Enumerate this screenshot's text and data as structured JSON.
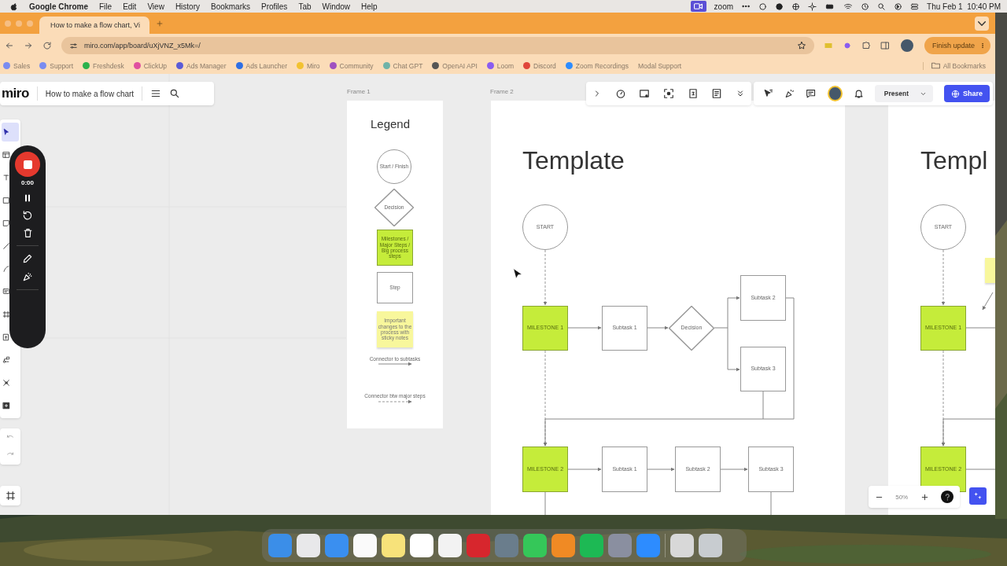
{
  "menu_bar": {
    "app_name": "Google Chrome",
    "menus": [
      "File",
      "Edit",
      "View",
      "History",
      "Bookmarks",
      "Profiles",
      "Tab",
      "Window",
      "Help"
    ],
    "zoom_label": "zoom",
    "clock": "Thu Feb 1  10:40 PM"
  },
  "browser": {
    "tabs": [
      {
        "title": "How to make a flow chart, Vi",
        "selected": true
      }
    ],
    "address": "miro.com/app/board/uXjVNZ_x5Mk=/",
    "update_button": "Finish update",
    "bookmarks": [
      "Sales",
      "Support",
      "Freshdesk",
      "ClickUp",
      "Ads Manager",
      "Ads Launcher",
      "Miro",
      "Community",
      "Chat GPT",
      "OpenAI API",
      "Loom",
      "Discord",
      "Zoom Recordings",
      "Modal Support"
    ],
    "all_bookmarks": "All Bookmarks"
  },
  "board": {
    "logo": "miro",
    "title": "How to make a flow chart",
    "tools": [
      {
        "selected": true
      },
      {
        "selected": false
      },
      {
        "selected": false
      },
      {
        "selected": false
      },
      {
        "selected": false
      },
      {
        "selected": false
      },
      {
        "selected": false
      },
      {
        "selected": false
      },
      {
        "selected": false
      },
      {
        "selected": false
      },
      {
        "selected": false
      },
      {
        "selected": false
      },
      {
        "selected": false
      }
    ],
    "recorder": {
      "time": "0:00"
    },
    "present_button": "Present",
    "share_button": "Share",
    "zoom_level": "50%",
    "frames": [
      {
        "label": "Frame 1",
        "title": "Legend",
        "items": [
          {
            "kind": "start",
            "label": "Start / Finish"
          },
          {
            "kind": "decision",
            "label": "Decision"
          },
          {
            "kind": "milestone",
            "label": "Milestones / Major Steps / Big process steps"
          },
          {
            "kind": "step",
            "label": "Step"
          },
          {
            "kind": "note",
            "label": "Important changes to the process with sticky notes"
          },
          {
            "kind": "connector",
            "label": "Connector to subtasks"
          },
          {
            "kind": "dashed_connector",
            "label": "Connector btw major steps"
          }
        ]
      },
      {
        "label": "Frame 2",
        "title": "Template",
        "nodes": [
          {
            "kind": "start",
            "label": "START"
          },
          {
            "kind": "milestone",
            "label": "MILESTONE 1"
          },
          {
            "kind": "step",
            "label": "Subtask 1"
          },
          {
            "kind": "decision",
            "label": "Decision"
          },
          {
            "kind": "step",
            "label": "Subtask 2"
          },
          {
            "kind": "step",
            "label": "Subtask 3"
          },
          {
            "kind": "milestone",
            "label": "MILESTONE 2"
          },
          {
            "kind": "step",
            "label": "Subtask 1"
          },
          {
            "kind": "step",
            "label": "Subtask 2"
          },
          {
            "kind": "step",
            "label": "Subtask 3"
          }
        ]
      },
      {
        "title": "Templ",
        "nodes": [
          {
            "kind": "start",
            "label": "START"
          },
          {
            "kind": "note"
          },
          {
            "kind": "milestone",
            "label": "MILESTONE 1"
          },
          {
            "kind": "milestone",
            "label": "MILESTONE 2"
          }
        ]
      }
    ]
  }
}
